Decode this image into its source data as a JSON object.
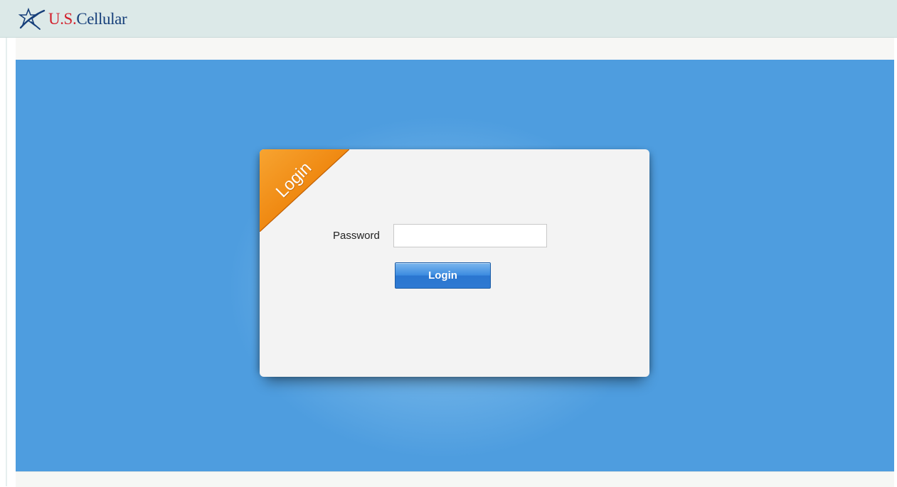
{
  "brand": {
    "logo_us": "U.S.",
    "logo_cellular": "Cellular",
    "icon": "star-swoosh-icon",
    "colors": {
      "red": "#d21f2b",
      "navy": "#163f7a"
    }
  },
  "login_card": {
    "ribbon_label": "Login",
    "password_label": "Password",
    "password_value": "",
    "password_placeholder": "",
    "submit_label": "Login"
  },
  "colors": {
    "header_bg": "#dce9e8",
    "stage_bg": "#4e9ddf",
    "ribbon_orange": "#f08a12",
    "button_blue": "#2f7ad2"
  }
}
